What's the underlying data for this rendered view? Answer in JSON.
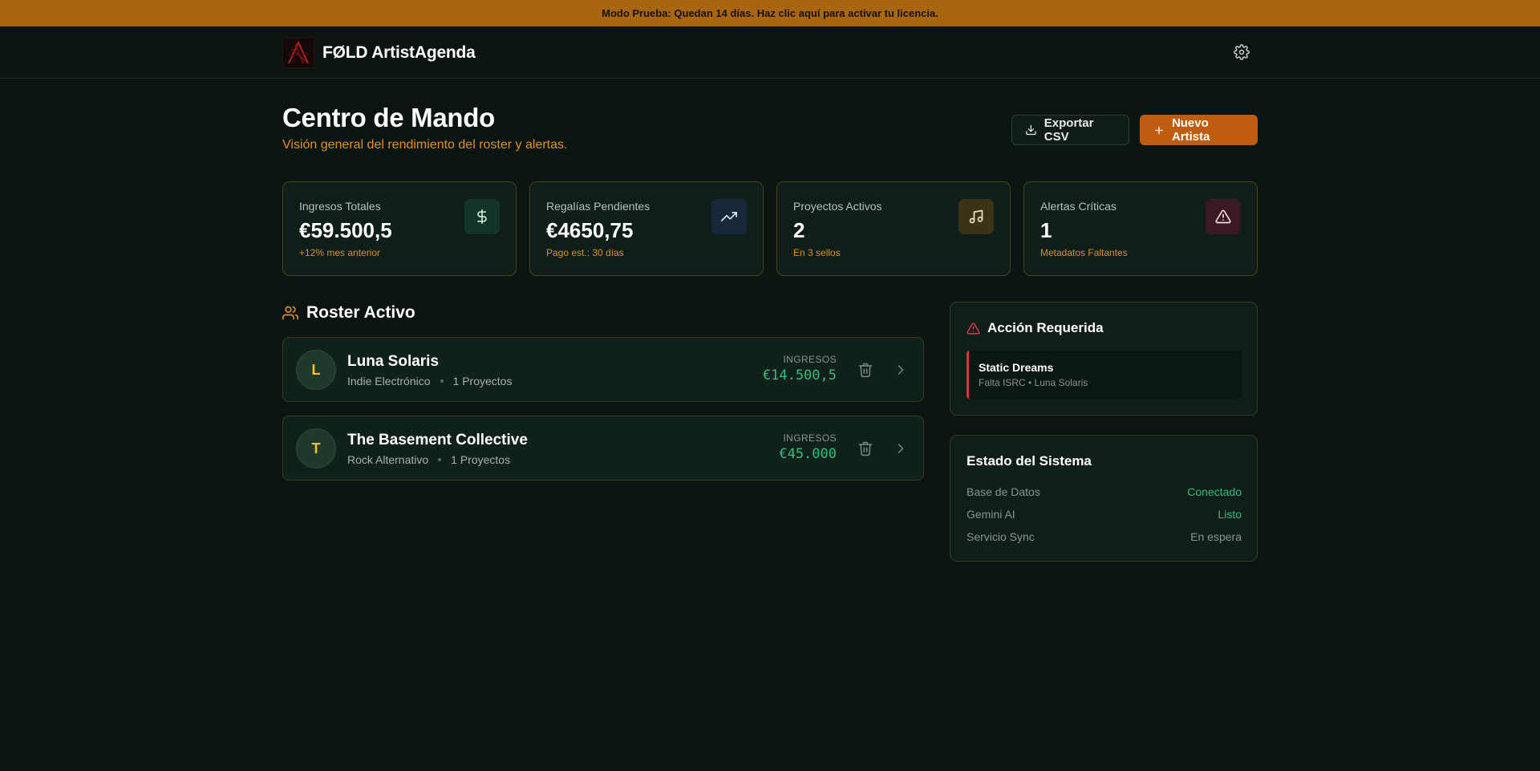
{
  "banner": {
    "text": "Modo Prueba: Quedan 14 días. Haz clic aquí para activar tu licencia."
  },
  "app": {
    "name": "FØLD ArtistAgenda"
  },
  "header": {
    "title": "Centro de Mando",
    "subtitle": "Visión general del rendimiento del roster y alertas.",
    "export_label": "Exportar CSV",
    "new_artist_label": "Nuevo Artista"
  },
  "kpis": [
    {
      "label": "Ingresos Totales",
      "value": "€59.500,5",
      "note": "+12% mes anterior",
      "icon": "dollar-icon",
      "icon_bg": "#123528",
      "icon_color": "#cfe9dc"
    },
    {
      "label": "Regalías Pendientes",
      "value": "€4650,75",
      "note": "Pago est.: 30 días",
      "icon": "trending-up-icon",
      "icon_bg": "#16283a",
      "icon_color": "#d5e3f2"
    },
    {
      "label": "Proyectos Activos",
      "value": "2",
      "note": "En 3 sellos",
      "icon": "music-icon",
      "icon_bg": "#3a3318",
      "icon_color": "#f1e7c7"
    },
    {
      "label": "Alertas Críticas",
      "value": "1",
      "note": "Metadatos Faltantes",
      "icon": "alert-triangle-icon",
      "icon_bg": "#3a1a22",
      "icon_color": "#f3dbe0"
    }
  ],
  "roster": {
    "title": "Roster Activo",
    "revenue_label": "INGRESOS",
    "artists": [
      {
        "initial": "L",
        "name": "Luna Solaris",
        "genre": "Indie Electrónico",
        "projects": "1 Proyectos",
        "revenue": "€14.500,5"
      },
      {
        "initial": "T",
        "name": "The Basement Collective",
        "genre": "Rock Alternativo",
        "projects": "1 Proyectos",
        "revenue": "€45.000"
      }
    ]
  },
  "action_required": {
    "title": "Acción Requerida",
    "items": [
      {
        "title": "Static Dreams",
        "subtitle": "Falta ISRC • Luna Solaris"
      }
    ]
  },
  "system_status": {
    "title": "Estado del Sistema",
    "rows": [
      {
        "key": "Base de Datos",
        "value": "Conectado",
        "color": "#2fbf7f"
      },
      {
        "key": "Gemini AI",
        "value": "Listo",
        "color": "#2fbf7f"
      },
      {
        "key": "Servicio Sync",
        "value": "En espera",
        "color": "#8a948e"
      }
    ]
  }
}
